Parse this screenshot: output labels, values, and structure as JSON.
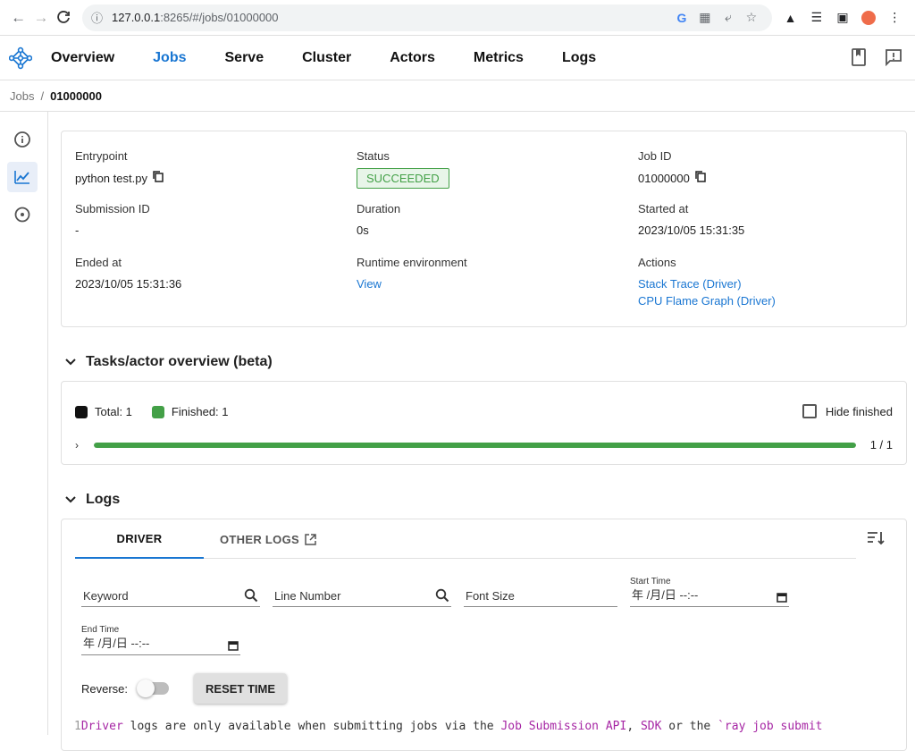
{
  "browser": {
    "url_host": "127.0.0.1",
    "url_path": ":8265/#/jobs/01000000"
  },
  "nav": {
    "items": [
      "Overview",
      "Jobs",
      "Serve",
      "Cluster",
      "Actors",
      "Metrics",
      "Logs"
    ],
    "active": "Jobs"
  },
  "breadcrumb": {
    "parent": "Jobs",
    "separator": "/",
    "current": "01000000"
  },
  "overview": {
    "entrypoint_label": "Entrypoint",
    "entrypoint_value": "python test.py",
    "status_label": "Status",
    "status_value": "SUCCEEDED",
    "jobid_label": "Job ID",
    "jobid_value": "01000000",
    "submission_label": "Submission ID",
    "submission_value": "-",
    "duration_label": "Duration",
    "duration_value": "0s",
    "started_label": "Started at",
    "started_value": "2023/10/05 15:31:35",
    "ended_label": "Ended at",
    "ended_value": "2023/10/05 15:31:36",
    "runtime_label": "Runtime environment",
    "runtime_link": "View",
    "actions_label": "Actions",
    "action_stack": "Stack Trace (Driver)",
    "action_flame": "CPU Flame Graph (Driver)"
  },
  "tasks": {
    "title": "Tasks/actor overview (beta)",
    "total_label": "Total: 1",
    "finished_label": "Finished: 1",
    "hide_finished": "Hide finished",
    "progress_text": "1 / 1",
    "progress_fraction": 1.0
  },
  "logs": {
    "title": "Logs",
    "tab_driver": "DRIVER",
    "tab_other": "OTHER LOGS",
    "keyword_placeholder": "Keyword",
    "line_placeholder": "Line Number",
    "font_placeholder": "Font Size",
    "start_label": "Start Time",
    "end_label": "End Time",
    "date_placeholder": "年 /月/日 --:--",
    "reverse_label": "Reverse:",
    "reset_button": "RESET TIME",
    "line_number": "1",
    "line_p1": "Driver",
    "line_p2": " logs are only available when submitting jobs via the ",
    "line_p3": "Job Submission API",
    "line_p4": ", ",
    "line_p5": "SDK",
    "line_p6": " or the ",
    "line_p7": "`ray job submit"
  },
  "colors": {
    "accent": "#1976d2",
    "success": "#43a047"
  }
}
